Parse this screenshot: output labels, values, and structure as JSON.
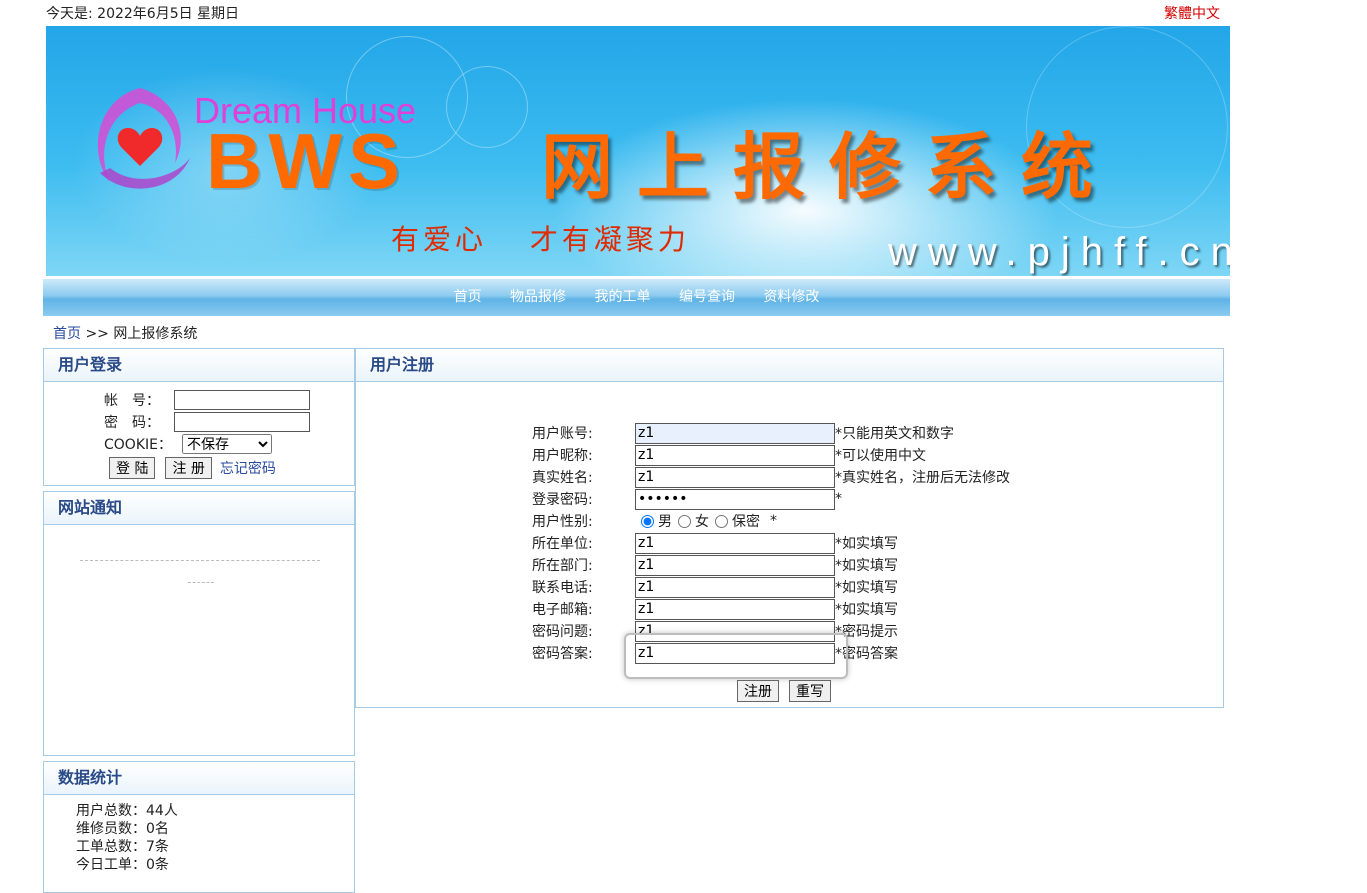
{
  "top": {
    "date": "今天是: 2022年6月5日 星期日",
    "lang_link": "繁體中文"
  },
  "banner": {
    "logo_top": "Dream House",
    "logo_main": "BWS",
    "title": "网上报修系统",
    "slogan": "有爱心 才有凝聚力",
    "url": "www.pjhff.cn"
  },
  "nav": [
    "首页",
    "物品报修",
    "我的工单",
    "编号查询",
    "资料修改"
  ],
  "breadcrumb": {
    "home": "首页",
    "sep": " >> ",
    "current": "网上报修系统"
  },
  "login": {
    "title": "用户登录",
    "account_label": "帐　号：",
    "password_label": "密　码：",
    "cookie_label": "COOKIE：",
    "cookie_selected": "不保存",
    "login_button": "登 陆",
    "register_button": "注 册",
    "forgot_link": "忘记密码"
  },
  "notice": {
    "title": "网站通知"
  },
  "stats": {
    "title": "数据统计",
    "lines": [
      "用户总数：44人",
      "维修员数：0名",
      "工单总数：7条",
      "今日工单：0条"
    ]
  },
  "register": {
    "title": "用户注册",
    "fields": [
      {
        "label": "用户账号:",
        "value": "z1",
        "hint": "*只能用英文和数字"
      },
      {
        "label": "用户昵称:",
        "value": "z1",
        "hint": "*可以使用中文"
      },
      {
        "label": "真实姓名:",
        "value": "z1",
        "hint": "*真实姓名，注册后无法修改"
      },
      {
        "label": "登录密码:",
        "value": "••••••",
        "hint": "*"
      },
      {
        "label": "用户性别:",
        "options": [
          "男",
          "女",
          "保密"
        ],
        "selected": "男",
        "hint": "*"
      },
      {
        "label": "所在单位:",
        "value": "z1",
        "hint": "*如实填写"
      },
      {
        "label": "所在部门:",
        "value": "z1",
        "hint": "*如实填写"
      },
      {
        "label": "联系电话:",
        "value": "z1",
        "hint": "*如实填写"
      },
      {
        "label": "电子邮箱:",
        "value": "z1",
        "hint": "*如实填写"
      },
      {
        "label": "密码问题:",
        "value": "z1",
        "hint": "*密码提示"
      },
      {
        "label": "密码答案:",
        "value": "z1",
        "hint": "*密码答案"
      }
    ],
    "submit_button": "注册",
    "reset_button": "重写"
  }
}
